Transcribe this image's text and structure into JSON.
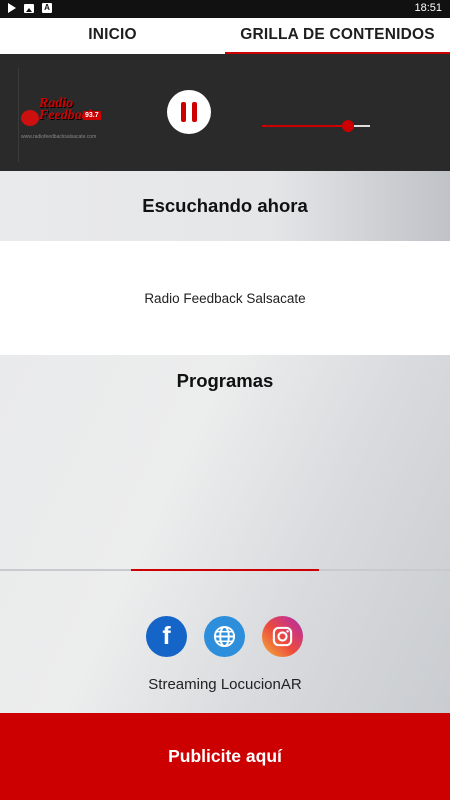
{
  "status_bar": {
    "time": "18:51",
    "icons": [
      "play-icon",
      "image-icon",
      "app-icon"
    ]
  },
  "tabs": [
    {
      "label": "INICIO",
      "active": false
    },
    {
      "label": "GRILLA DE CONTENIDOS",
      "active": true
    }
  ],
  "player": {
    "logo": {
      "line1": "Radio",
      "line2": "Feedback",
      "freq": "93.7",
      "url": "www.radiofeedbacksalsacate.com"
    },
    "state": "playing",
    "pause_icon": "pause-icon",
    "volume": 0.8
  },
  "now_playing": {
    "heading": "Escuchando ahora",
    "station": "Radio Feedback Salsacate"
  },
  "programs": {
    "heading": "Programas"
  },
  "social": [
    {
      "name": "facebook",
      "icon": "facebook-icon",
      "color": "#1565c8"
    },
    {
      "name": "website",
      "icon": "globe-icon",
      "color": "#2d8fdc"
    },
    {
      "name": "instagram",
      "icon": "instagram-icon",
      "color": "#e1306c"
    }
  ],
  "credits": "Streaming LocucionAR",
  "footer": {
    "label": "Publicite aquí"
  },
  "colors": {
    "accent": "#cc0000",
    "player_bg": "#2a2a2a"
  }
}
